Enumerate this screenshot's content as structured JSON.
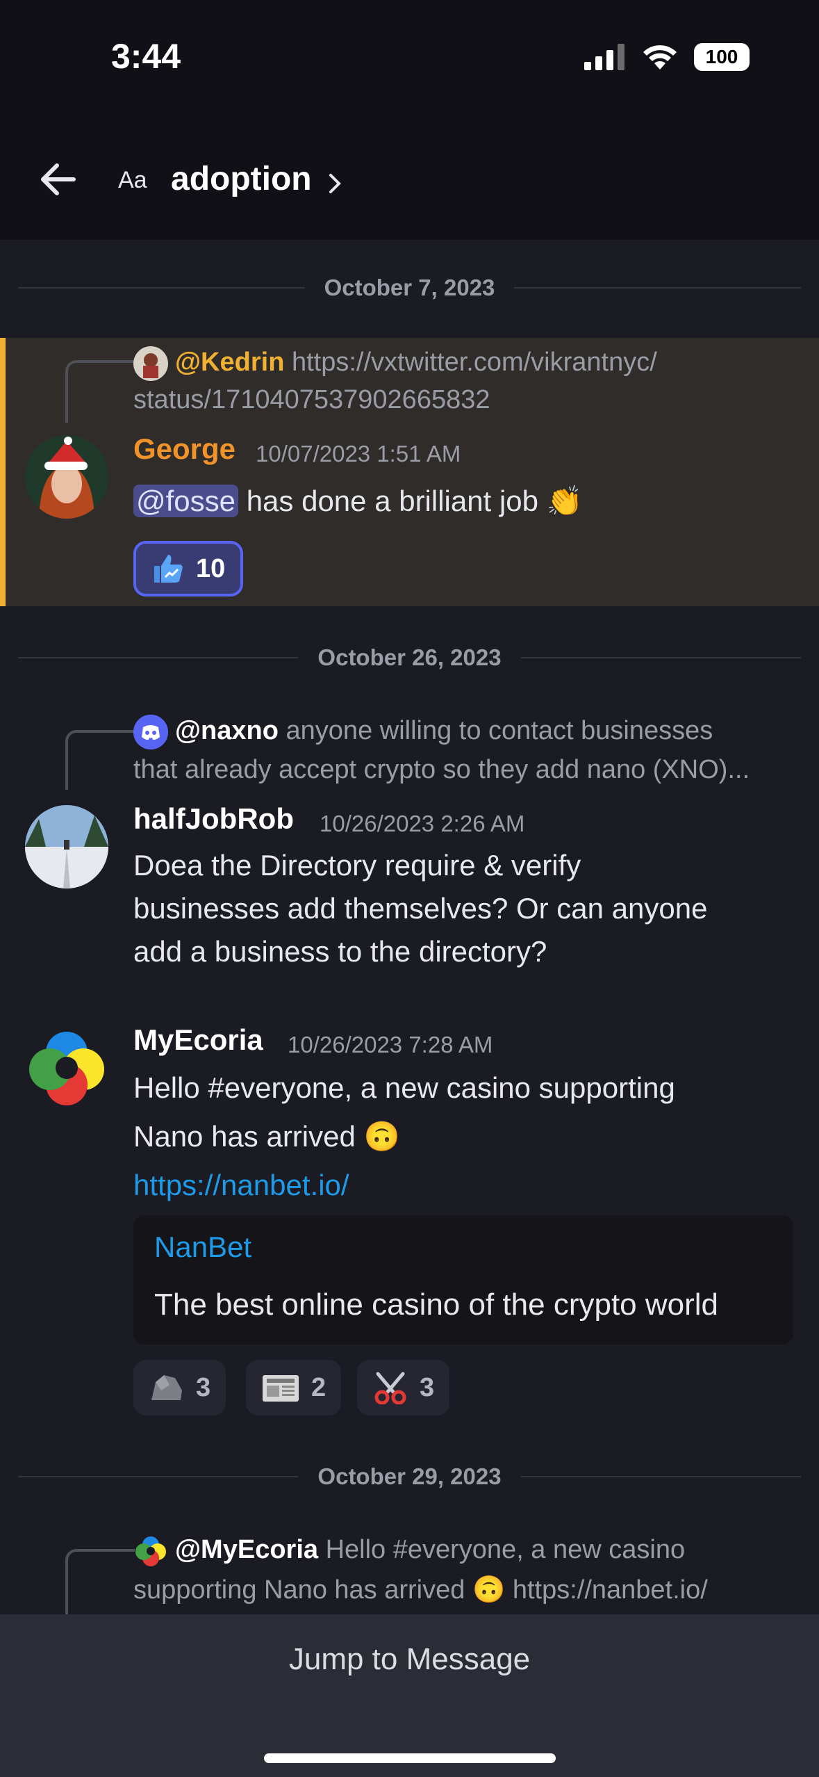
{
  "status_bar": {
    "time": "3:44",
    "battery": "100"
  },
  "header": {
    "aa_label": "Aa",
    "channel": "adoption"
  },
  "dates": {
    "d1": "October 7, 2023",
    "d2": "October 26, 2023",
    "d3": "October 29, 2023"
  },
  "messages": [
    {
      "reply_name": "@Kedrin",
      "reply_text_1": "https://vxtwitter.com/vikrantnyc/",
      "reply_text_2": "status/1710407537902665832",
      "author": "George",
      "time": "10/07/2023 1:51 AM",
      "mention": "@fosse",
      "text": " has done a brilliant job 👏",
      "reaction_count": "10"
    },
    {
      "reply_name": "@naxno",
      "reply_text_1": "anyone willing to contact businesses",
      "reply_text_2": "that already accept crypto so they add nano (XNO)...",
      "author": "halfJobRob",
      "time": "10/26/2023 2:26 AM",
      "lines": [
        "Doea the Directory require & verify",
        "businesses add themselves? Or can anyone",
        "add a business to the directory?"
      ]
    },
    {
      "author": "MyEcoria",
      "time": "10/26/2023 7:28 AM",
      "lines": [
        "Hello #everyone, a new casino supporting",
        "Nano has arrived 🙃"
      ],
      "link": "https://nanbet.io/",
      "embed_title": "NanBet",
      "embed_desc": "The best online casino of the crypto world",
      "reactions": [
        {
          "emoji": "rock",
          "count": "3"
        },
        {
          "emoji": "newspaper",
          "count": "2"
        },
        {
          "emoji": "scissors",
          "count": "3"
        }
      ]
    },
    {
      "reply_name": "@MyEcoria",
      "reply_text_1": "Hello #everyone, a new casino",
      "reply_text_2": "supporting Nano has arrived 🙃 https://nanbet.io/"
    }
  ],
  "bottom": {
    "jump_label": "Jump to Message"
  },
  "colors": {
    "george": "#f0932b",
    "kedrin": "#f0b132",
    "accent": "#5865f2",
    "link": "#1e9be8"
  }
}
